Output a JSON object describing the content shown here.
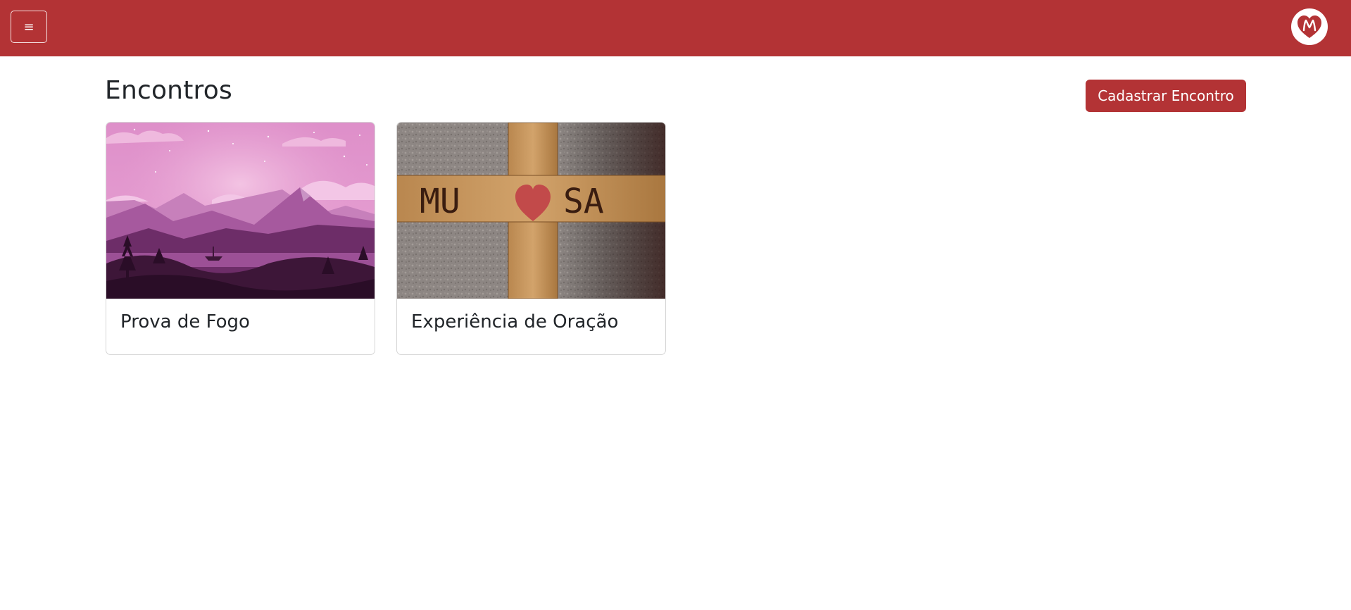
{
  "header": {
    "menu_glyph": "≡",
    "menu_icon": "hamburger-icon",
    "logo_icon": "heart-m-logo",
    "brand_color": "#b33335"
  },
  "main": {
    "title": "Encontros",
    "create_button_label": "Cadastrar Encontro"
  },
  "cards": [
    {
      "title": "Prova de Fogo",
      "image": "purple-mountain-landscape"
    },
    {
      "title": "Experiência de Oração",
      "image": "wooden-cross-mu-heart-sa"
    }
  ],
  "cross_letters": {
    "left": "MU",
    "right": "SA"
  }
}
